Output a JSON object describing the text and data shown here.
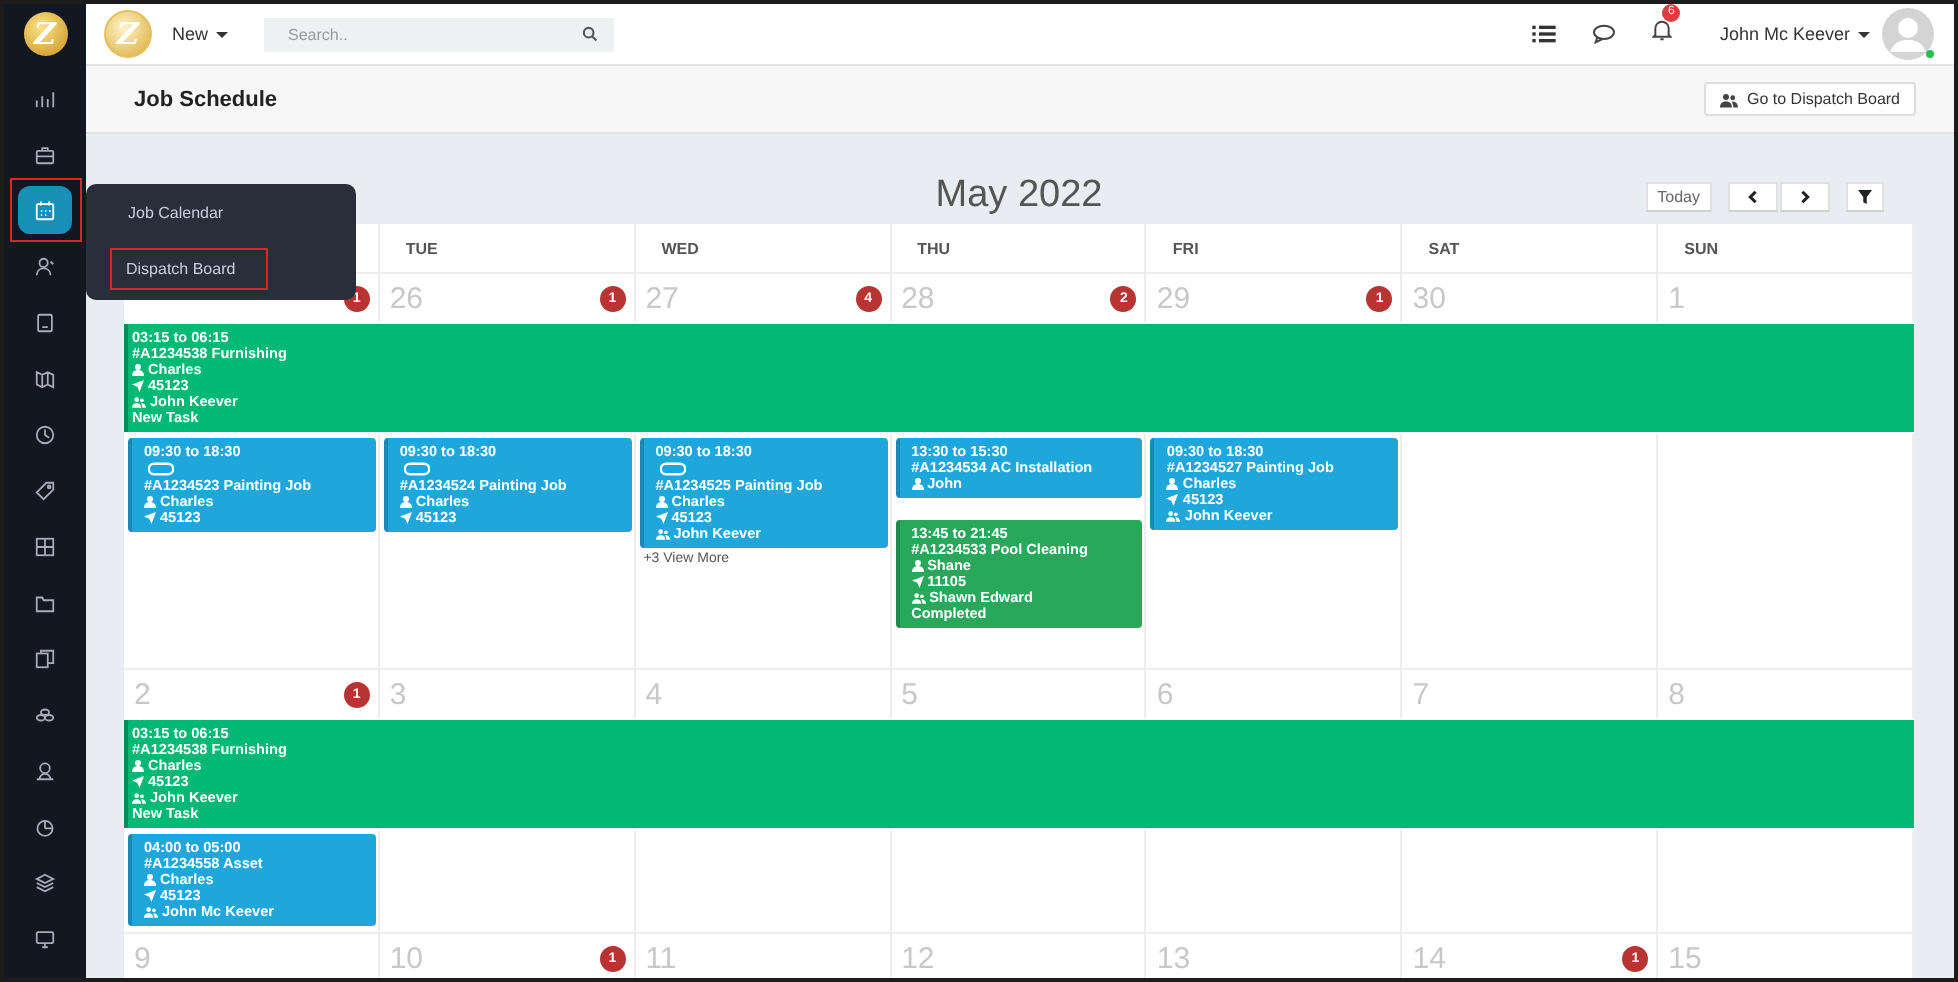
{
  "sidebar": {
    "logo": "Z",
    "items": [
      {
        "selected": false,
        "highlighted": false
      },
      {
        "selected": false,
        "highlighted": false
      },
      {
        "selected": true,
        "highlighted": true
      },
      {
        "selected": false,
        "highlighted": false
      },
      {
        "selected": false,
        "highlighted": false
      },
      {
        "selected": false,
        "highlighted": false
      },
      {
        "selected": false,
        "highlighted": false
      },
      {
        "selected": false,
        "highlighted": false
      },
      {
        "selected": false,
        "highlighted": false
      },
      {
        "selected": false,
        "highlighted": false
      },
      {
        "selected": false,
        "highlighted": false
      },
      {
        "selected": false,
        "highlighted": false
      },
      {
        "selected": false,
        "highlighted": false
      },
      {
        "selected": false,
        "highlighted": false
      },
      {
        "selected": false,
        "highlighted": false
      },
      {
        "selected": false,
        "highlighted": false
      }
    ]
  },
  "flyout_menu": [
    {
      "label": "Job Calendar",
      "highlighted": false
    },
    {
      "label": "Dispatch Board",
      "highlighted": true
    }
  ],
  "topbar": {
    "logo": "Z",
    "new_menu": "New",
    "search": {
      "placeholder": "Search.."
    },
    "notifications": "6",
    "user": "John Mc Keever"
  },
  "page": {
    "title": "Job Schedule",
    "dispatch_button": "Go to Dispatch Board"
  },
  "calendar": {
    "title": "May 2022",
    "today_button": "Today",
    "weekdays": [
      "TUE",
      "WED",
      "THU",
      "FRI",
      "SAT",
      "SUN"
    ],
    "weeks": [
      {
        "days": [
          {
            "badge": "1"
          },
          {
            "number": "26",
            "badge": "1"
          },
          {
            "number": "27",
            "badge": "4"
          },
          {
            "number": "28",
            "badge": "2"
          },
          {
            "number": "29",
            "badge": "1"
          },
          {
            "number": "30"
          },
          {
            "number": "1"
          }
        ],
        "banner": {
          "time": "03:15 to 06:15",
          "title": "#A1234538 Furnishing",
          "assignee": "Charles",
          "zip": "45123",
          "team": "John Keever",
          "status": "New Task",
          "color": "#02b875"
        },
        "cells": [
          {
            "events": [
              {
                "time": "09:30 to 18:30",
                "repeat": true,
                "title": "#A1234523 Painting Job",
                "assignee": "Charles",
                "zip": "45123",
                "color": "#1fa7dc"
              }
            ]
          },
          {
            "events": [
              {
                "time": "09:30 to 18:30",
                "repeat": true,
                "title": "#A1234524 Painting Job",
                "assignee": "Charles",
                "zip": "45123",
                "color": "#1fa7dc"
              }
            ]
          },
          {
            "events": [
              {
                "time": "09:30 to 18:30",
                "repeat": true,
                "title": "#A1234525 Painting Job",
                "assignee": "Charles",
                "zip": "45123",
                "team": "John Keever",
                "color": "#1fa7dc"
              }
            ],
            "more": "+3 View More"
          },
          {
            "events": [
              {
                "time": "13:30 to 15:30",
                "repeat": false,
                "title": "#A1234534 AC Installation",
                "assignee": "John",
                "color": "#1fa7dc"
              },
              {
                "time": "13:45 to 21:45",
                "repeat": false,
                "title": "#A1234533 Pool Cleaning",
                "assignee": "Shane",
                "zip": "11105",
                "team": "Shawn Edward",
                "status": "Completed",
                "color": "#27a85a"
              }
            ]
          },
          {
            "events": [
              {
                "time": "09:30 to 18:30",
                "repeat": false,
                "title": "#A1234527 Painting Job",
                "assignee": "Charles",
                "zip": "45123",
                "team": "John Keever",
                "color": "#1fa7dc"
              }
            ]
          },
          {},
          {}
        ]
      },
      {
        "days": [
          {
            "number": "2",
            "badge": "1"
          },
          {
            "number": "3"
          },
          {
            "number": "4"
          },
          {
            "number": "5"
          },
          {
            "number": "6"
          },
          {
            "number": "7"
          },
          {
            "number": "8"
          }
        ],
        "banner": {
          "time": "03:15 to 06:15",
          "title": "#A1234538 Furnishing",
          "assignee": "Charles",
          "zip": "45123",
          "team": "John Keever",
          "status": "New Task",
          "color": "#02b875"
        },
        "cells": [
          {
            "events": [
              {
                "time": "04:00 to 05:00",
                "repeat": false,
                "title": "#A1234558 Asset",
                "assignee": "Charles",
                "zip": "45123",
                "team": "John Mc Keever",
                "color": "#1fa7dc"
              }
            ]
          },
          {},
          {},
          {},
          {},
          {},
          {}
        ]
      },
      {
        "days": [
          {
            "number": "9"
          },
          {
            "number": "10",
            "badge": "1"
          },
          {
            "number": "11"
          },
          {
            "number": "12"
          },
          {
            "number": "13"
          },
          {
            "number": "14",
            "badge": "1"
          },
          {
            "number": "15"
          }
        ]
      }
    ]
  }
}
